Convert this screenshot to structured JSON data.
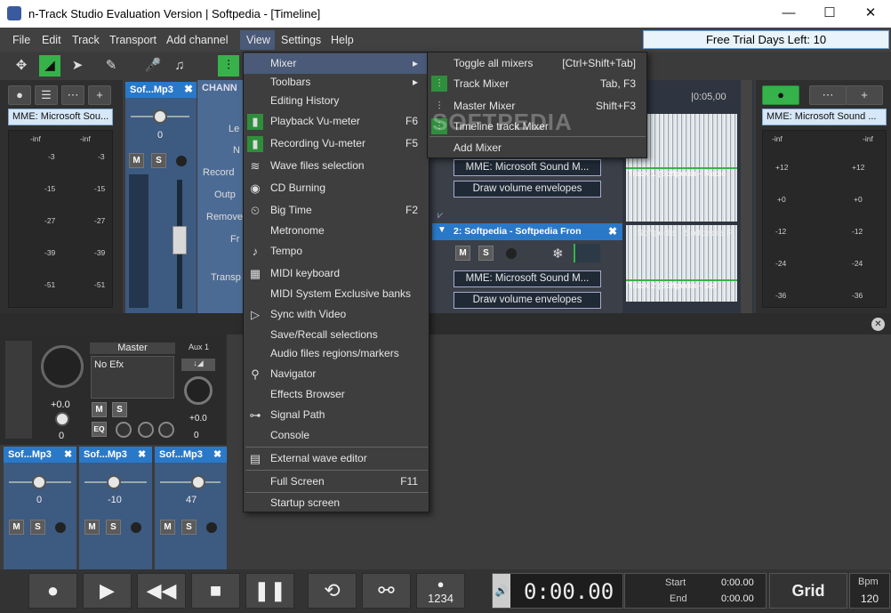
{
  "window": {
    "title": "n-Track Studio Evaluation Version | Softpedia - [Timeline]",
    "min": "—",
    "max": "☐",
    "close": "✕"
  },
  "menubar": {
    "items": [
      "File",
      "Edit",
      "Track",
      "Transport",
      "Add channel",
      "View",
      "Settings",
      "Help"
    ],
    "trial": "Free Trial Days Left: 10"
  },
  "left_mixer": {
    "device": "MME: Microsoft Sou...",
    "scale": [
      "-inf",
      "-3",
      "-15",
      "-27",
      "-39",
      "-51"
    ]
  },
  "channel": {
    "name": "Sof...Mp3",
    "value": "0",
    "m": "M",
    "s": "S",
    "header": "CHANN",
    "labels": [
      "Le",
      "N",
      "Record",
      "Outp",
      "Remove",
      "Fr",
      "Transp"
    ]
  },
  "timeline": {
    "time1": "|0:05,00",
    "tracks": [
      {
        "name": "2: Softpedia - Softpedia Fron",
        "device": "MME: Microsoft Sound M...",
        "envelopes": "Draw volume envelopes",
        "clip": "Softpedia - Softpedia F",
        "clip_label": "Track 2 (Softpedia - Sof"
      },
      {
        "device": "MME: Microsoft Sound M...",
        "envelopes": "Draw volume envelopes",
        "clip_label": "Track 1 (Softpedia - Radio"
      }
    ]
  },
  "right_mixer": {
    "device": "MME: Microsoft Sound ...",
    "scale": [
      "-inf",
      "+12",
      "+0",
      "-12",
      "-24",
      "-36"
    ]
  },
  "master": {
    "label": "Master",
    "efx": "No Efx",
    "aux": "Aux 1",
    "vol": "+0.0",
    "val": "0",
    "aux_vol": "+0.0",
    "aux_val": "0",
    "eq": "EQ",
    "m": "M",
    "s": "S"
  },
  "bottom_strips": [
    {
      "name": "Sof...Mp3",
      "val": "0"
    },
    {
      "name": "Sof...Mp3",
      "val": "-10"
    },
    {
      "name": "Sof...Mp3",
      "val": "47"
    }
  ],
  "view_menu": [
    {
      "label": "Mixer",
      "sc": "",
      "icon": "",
      "arrow": "▸"
    },
    {
      "label": "Toolbars",
      "sc": "",
      "icon": "",
      "arrow": "▸"
    },
    {
      "label": "Editing History",
      "sc": "",
      "icon": ""
    },
    {
      "label": "Playback Vu-meter",
      "sc": "F6",
      "icon": "▮"
    },
    {
      "label": "Recording Vu-meter",
      "sc": "F5",
      "icon": "▮"
    },
    {
      "label": "Wave files selection",
      "sc": "",
      "icon": "≋"
    },
    {
      "label": "CD Burning",
      "sc": "",
      "icon": "◉"
    },
    {
      "label": "Big Time",
      "sc": "F2",
      "icon": "⏲"
    },
    {
      "label": "Metronome",
      "sc": "",
      "icon": ""
    },
    {
      "label": "Tempo",
      "sc": "",
      "icon": "♪"
    },
    {
      "label": "MIDI keyboard",
      "sc": "",
      "icon": "▦"
    },
    {
      "label": "MIDI System Exclusive banks",
      "sc": "",
      "icon": ""
    },
    {
      "label": "Sync with Video",
      "sc": "",
      "icon": "▷"
    },
    {
      "label": "Save/Recall selections",
      "sc": "",
      "icon": ""
    },
    {
      "label": "Audio files regions/markers",
      "sc": "",
      "icon": ""
    },
    {
      "label": "Navigator",
      "sc": "",
      "icon": "⚲"
    },
    {
      "label": "Effects Browser",
      "sc": "",
      "icon": ""
    },
    {
      "label": "Signal Path",
      "sc": "",
      "icon": "⊶"
    },
    {
      "label": "Console",
      "sc": "",
      "icon": ""
    },
    {
      "label": "External wave editor",
      "sc": "",
      "icon": "▤"
    },
    {
      "label": "Full Screen",
      "sc": "F11",
      "icon": ""
    },
    {
      "label": "Startup screen",
      "sc": "",
      "icon": ""
    }
  ],
  "mixer_submenu": [
    {
      "label": "Toggle all mixers",
      "sc": "[Ctrl+Shift+Tab]"
    },
    {
      "label": "Track Mixer",
      "sc": "Tab, F3"
    },
    {
      "label": "Master Mixer",
      "sc": "Shift+F3"
    },
    {
      "label": "Timeline track Mixer",
      "sc": ""
    },
    {
      "label": "Add Mixer",
      "sc": ""
    }
  ],
  "transport": {
    "time": "0:00.00",
    "start_label": "Start",
    "end_label": "End",
    "start": "0:00.00",
    "end": "0:00.00",
    "grid": "Grid",
    "bpm_label": "Bpm",
    "bpm": "120",
    "count": "1234"
  },
  "watermark": "SOFTPEDIA"
}
